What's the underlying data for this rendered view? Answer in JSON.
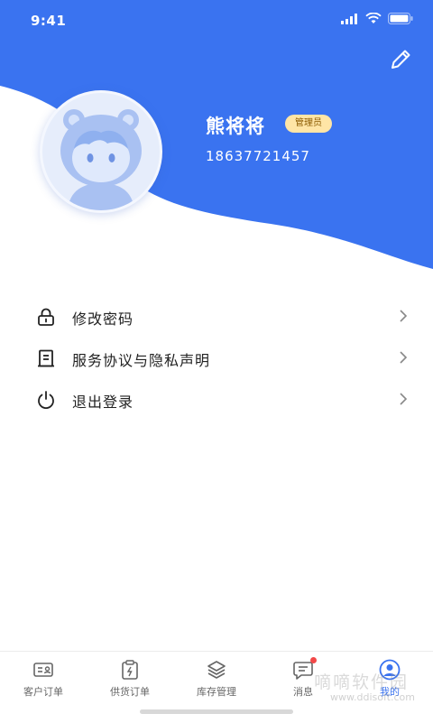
{
  "colors": {
    "primary": "#3a73f0",
    "badge_bg": "#ffe5a6",
    "badge_text": "#8a5a00",
    "dot": "#f24848"
  },
  "status_bar": {
    "time": "9:41",
    "icons": [
      "signal-icon",
      "wifi-icon",
      "battery-icon"
    ]
  },
  "header": {
    "edit_icon": "pencil-icon",
    "username": "熊将将",
    "role_badge": "管理员",
    "phone": "18637721457",
    "avatar_icon": "cartoon-avatar"
  },
  "menu": {
    "items": [
      {
        "label": "修改密码",
        "icon": "lock-icon"
      },
      {
        "label": "服务协议与隐私声明",
        "icon": "document-icon"
      },
      {
        "label": "退出登录",
        "icon": "power-icon"
      }
    ]
  },
  "tabbar": {
    "items": [
      {
        "label": "客户订单",
        "icon": "customer-order-icon",
        "active": false
      },
      {
        "label": "供货订单",
        "icon": "supply-order-icon",
        "active": false
      },
      {
        "label": "库存管理",
        "icon": "inventory-icon",
        "active": false
      },
      {
        "label": "消息",
        "icon": "message-icon",
        "active": false,
        "badge": true
      },
      {
        "label": "我的",
        "icon": "profile-icon",
        "active": true
      }
    ]
  },
  "watermark": {
    "text": "嘀嘀软件园",
    "url": "www.ddisoft.com"
  }
}
